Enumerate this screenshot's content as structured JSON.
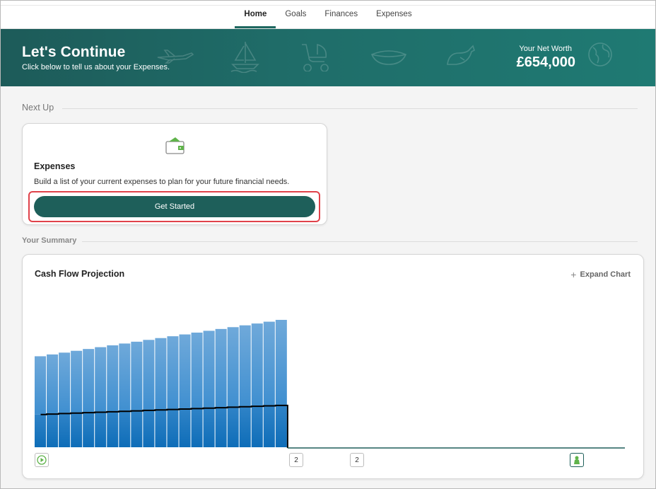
{
  "nav": {
    "tabs": [
      {
        "label": "Home",
        "active": true
      },
      {
        "label": "Goals",
        "active": false
      },
      {
        "label": "Finances",
        "active": false
      },
      {
        "label": "Expenses",
        "active": false
      }
    ]
  },
  "banner": {
    "title": "Let's Continue",
    "subtitle": "Click below to tell us about your Expenses.",
    "net_worth_label": "Your Net Worth",
    "net_worth_value": "£654,000",
    "background_color": "#1f6d69"
  },
  "next_up": {
    "heading": "Next Up",
    "card": {
      "icon": "wallet-icon",
      "title": "Expenses",
      "description": "Build a list of your current expenses to plan for your future financial needs.",
      "button_label": "Get Started",
      "button_color": "#1e5f5a",
      "highlight_color": "#e0424a"
    }
  },
  "summary": {
    "heading": "Your Summary",
    "chart_title": "Cash Flow Projection",
    "expand_label": "Expand Chart",
    "markers": [
      {
        "label": "",
        "icon": "play-icon"
      },
      {
        "label": "2"
      },
      {
        "label": "2"
      },
      {
        "label": "",
        "icon": "retirement-icon"
      }
    ]
  },
  "chart_data": {
    "type": "bar",
    "title": "Cash Flow Projection",
    "xlabel": "",
    "ylabel": "",
    "bar_color": "#3f8fd0",
    "line_color": "#000000",
    "bar_count": 21,
    "total_slots": 49,
    "values": [
      100,
      102,
      104,
      106,
      108,
      110,
      112,
      114,
      116,
      118,
      120,
      122,
      124,
      126,
      128,
      130,
      132,
      134,
      136,
      138,
      140
    ],
    "line_values": [
      36,
      36.5,
      37,
      37.5,
      38,
      38.5,
      39,
      39.5,
      40,
      40.5,
      41,
      41.5,
      42,
      42.5,
      43,
      43.5,
      44,
      44.5,
      45,
      45.5,
      46
    ],
    "ylim": [
      0,
      140
    ],
    "grid": false,
    "legend": "none"
  }
}
